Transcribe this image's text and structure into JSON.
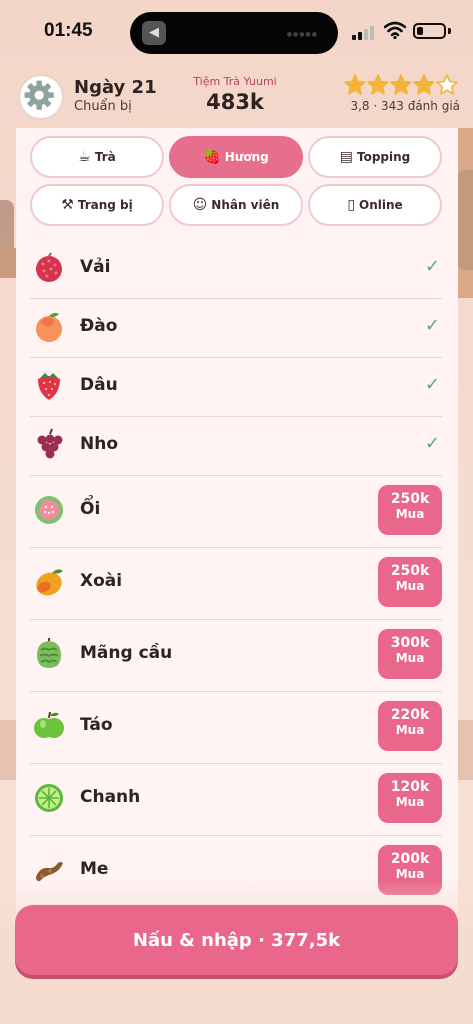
{
  "status_bar": {
    "time": "01:45",
    "icons": [
      "speaker-icon",
      "signal-icon",
      "wifi-icon",
      "battery-icon"
    ]
  },
  "header": {
    "day_title": "Ngày 21",
    "day_status": "Chuẩn bị",
    "shop_name": "Tiệm Trà Yuumi",
    "money": "483k",
    "stars_filled": 4,
    "stars_total": 5,
    "rating_text": "3,8 · 343 đánh giá",
    "settings_icon": "gear-icon",
    "star_color": "#f3b43a"
  },
  "tabs": [
    {
      "label": "Trà",
      "icon": "teapot-icon",
      "active": false
    },
    {
      "label": "Hương",
      "icon": "strawberry-icon",
      "active": true
    },
    {
      "label": "Topping",
      "icon": "topping-box-icon",
      "active": false
    },
    {
      "label": "Trang bị",
      "icon": "tools-icon",
      "active": false
    },
    {
      "label": "Nhân viên",
      "icon": "staff-icon",
      "active": false
    },
    {
      "label": "Online",
      "icon": "phone-icon",
      "active": false
    }
  ],
  "flavors": [
    {
      "name": "Vải",
      "icon": "lychee-icon",
      "owned": true
    },
    {
      "name": "Đào",
      "icon": "peach-icon",
      "owned": true
    },
    {
      "name": "Dâu",
      "icon": "strawberry-icon",
      "owned": true
    },
    {
      "name": "Nho",
      "icon": "grape-icon",
      "owned": true
    },
    {
      "name": "Ổi",
      "icon": "guava-icon",
      "owned": false,
      "price": "250k",
      "buy_label": "Mua"
    },
    {
      "name": "Xoài",
      "icon": "mango-icon",
      "owned": false,
      "price": "250k",
      "buy_label": "Mua"
    },
    {
      "name": "Mãng cầu",
      "icon": "soursop-icon",
      "owned": false,
      "price": "300k",
      "buy_label": "Mua"
    },
    {
      "name": "Táo",
      "icon": "apple-icon",
      "owned": false,
      "price": "220k",
      "buy_label": "Mua"
    },
    {
      "name": "Chanh",
      "icon": "lime-icon",
      "owned": false,
      "price": "120k",
      "buy_label": "Mua"
    },
    {
      "name": "Me",
      "icon": "tamarind-icon",
      "owned": false,
      "price": "200k",
      "buy_label": "Mua"
    }
  ],
  "check_mark": "✓",
  "cook_button": "Nấu & nhập · 377,5k",
  "colors": {
    "accent": "#e8678a",
    "check": "#5aa58a",
    "panel": "#fff3f4"
  }
}
